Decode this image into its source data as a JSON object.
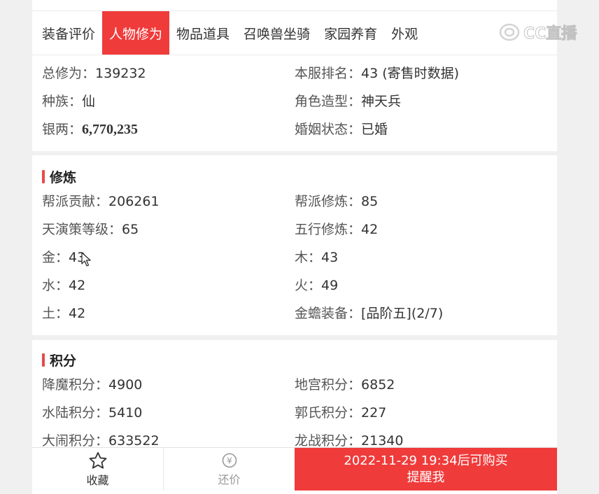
{
  "tabs": [
    {
      "label": "装备评价",
      "active": false
    },
    {
      "label": "人物修为",
      "active": true
    },
    {
      "label": "物品道具",
      "active": false
    },
    {
      "label": "召唤兽坐骑",
      "active": false
    },
    {
      "label": "家园养育",
      "active": false
    },
    {
      "label": "外观",
      "active": false
    }
  ],
  "watermark": "CC直播",
  "profile": {
    "total_cultivation": {
      "label": "总修为：",
      "value": "139232"
    },
    "server_rank": {
      "label": "本服排名：",
      "value": "43 (寄售时数据)"
    },
    "race": {
      "label": "种族：",
      "value": "仙"
    },
    "character_model": {
      "label": "角色造型：",
      "value": "神天兵"
    },
    "silver": {
      "label": "银两：",
      "value": "6,770,235"
    },
    "marriage": {
      "label": "婚姻状态：",
      "value": "已婚"
    }
  },
  "cultivation": {
    "title": "修炼",
    "rows": [
      {
        "label": "帮派贡献：",
        "value": "206261"
      },
      {
        "label": "帮派修炼：",
        "value": "85"
      },
      {
        "label": "天演策等级：",
        "value": "65"
      },
      {
        "label": "五行修炼：",
        "value": "42"
      },
      {
        "label": "金：",
        "value": "43"
      },
      {
        "label": "木：",
        "value": "43"
      },
      {
        "label": "水：",
        "value": "42"
      },
      {
        "label": "火：",
        "value": "49"
      },
      {
        "label": "土：",
        "value": "42"
      },
      {
        "label": "金蟾装备：",
        "value": "[品阶五](2/7)"
      }
    ]
  },
  "scores": {
    "title": "积分",
    "rows": [
      {
        "label": "降魔积分：",
        "value": "4900"
      },
      {
        "label": "地宫积分：",
        "value": "6852"
      },
      {
        "label": "水陆积分：",
        "value": "5410"
      },
      {
        "label": "郭氏积分：",
        "value": "227"
      },
      {
        "label": "大闹积分：",
        "value": "633522"
      },
      {
        "label": "龙战积分：",
        "value": "21340"
      }
    ]
  },
  "bottom_bar": {
    "favorite_label": "收藏",
    "bargain_label": "还价",
    "purchase_time": "2022-11-29 19:34后可购买",
    "remind_label": "提醒我"
  },
  "colors": {
    "accent_red": "#f03b3b",
    "silver_value": "#e3e35a",
    "section_bar": "#e84b4b"
  }
}
